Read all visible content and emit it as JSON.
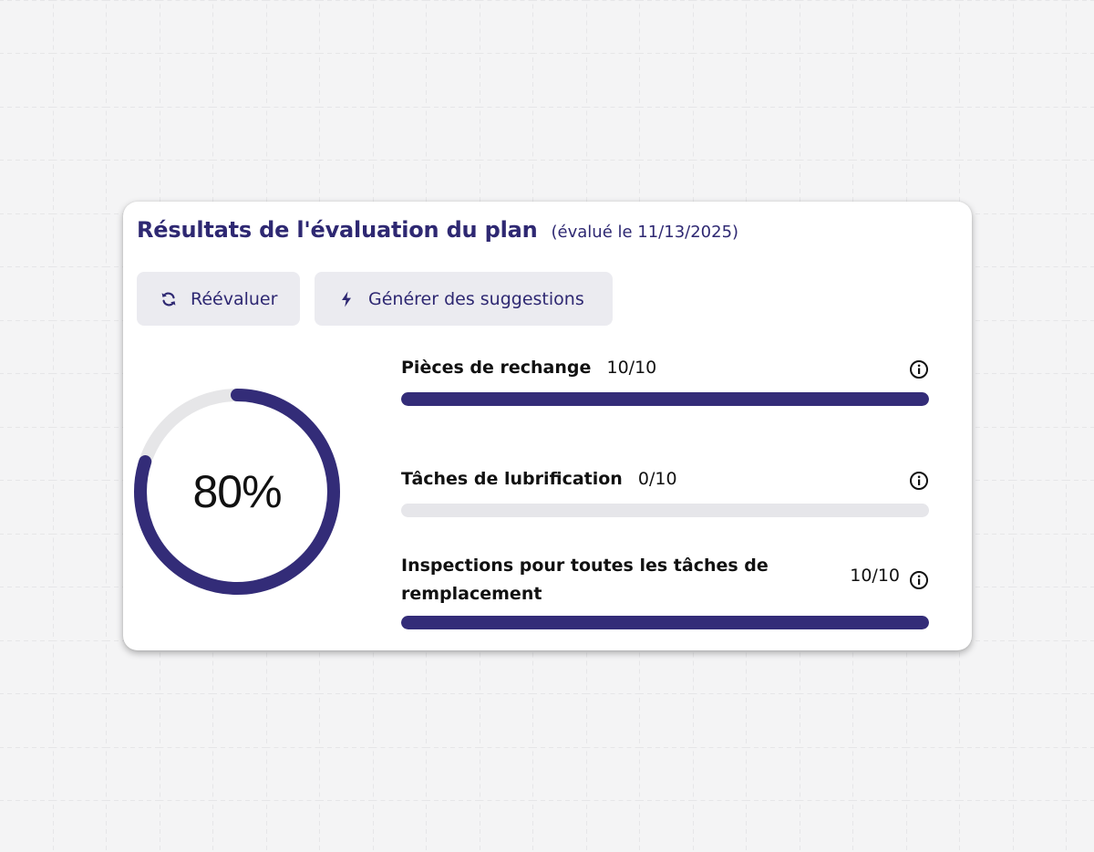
{
  "header": {
    "title": "Résultats de l'évaluation du plan",
    "evaluated": "(évalué le 11/13/2025)"
  },
  "actions": {
    "reevaluate_label": "Réévaluer",
    "reevaluate_icon": "refresh-icon",
    "suggest_label": "Générer des suggestions",
    "suggest_icon": "bolt-icon"
  },
  "score": {
    "value": 80,
    "label": "80%"
  },
  "metrics": [
    {
      "name": "Pièces de rechange",
      "score": "10/10",
      "fraction": 1.0
    },
    {
      "name": "Tâches de lubrification",
      "score": "0/10",
      "fraction": 0.0
    },
    {
      "name": "Inspections pour toutes les tâches de remplacement",
      "score": "10/10",
      "fraction": 1.0
    }
  ],
  "colors": {
    "accent": "#332c78",
    "title": "#2e2872",
    "track": "#e6e6ea",
    "button_bg": "#ebebf0"
  }
}
